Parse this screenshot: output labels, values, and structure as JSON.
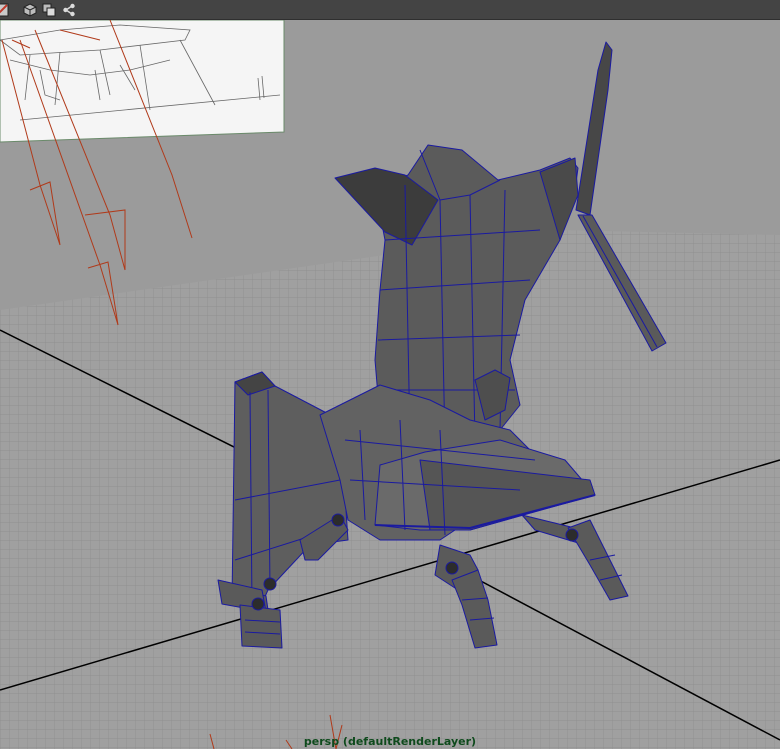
{
  "viewport": {
    "camera_label": "persp (defaultRenderLayer)"
  },
  "toolbar": {
    "icons": [
      "grid-icon",
      "cube-icon",
      "copy-icon",
      "share-icon"
    ]
  },
  "colors": {
    "background": "#9b9b9b",
    "grid_line": "#8c8c8c",
    "grid_axis": "#000000",
    "mesh_fill": "#5c5c5c",
    "wireframe": "#1a1aa0",
    "light_arrow": "#b03a1a",
    "camera_label": "#0e4a1c"
  }
}
